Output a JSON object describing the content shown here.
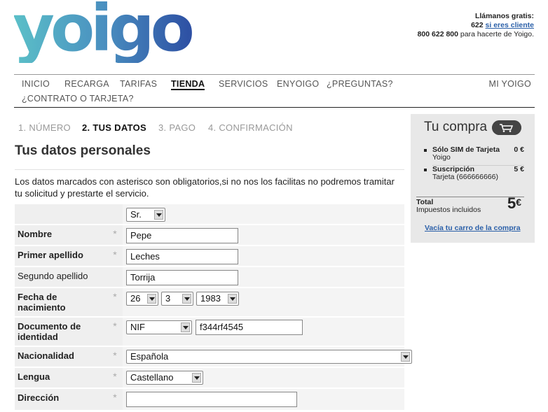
{
  "logo": {
    "text": "yoigo"
  },
  "contact": {
    "line1": "Llámanos gratis:",
    "line2_num": "622",
    "line2_link": "si eres cliente",
    "line3_num": "800 622 800",
    "line3_rest": " para hacerte de Yoigo."
  },
  "nav": {
    "items": [
      "INICIO",
      "RECARGA",
      "TARIFAS",
      "TIENDA",
      "SERVICIOS",
      "ENYOIGO",
      "¿PREGUNTAS?",
      "MI YOIGO",
      "¿CONTRATO O TARJETA?"
    ]
  },
  "steps": [
    "1. NÚMERO",
    "2. TUS DATOS",
    "3. PAGO",
    "4. CONFIRMACIÓN"
  ],
  "page": {
    "title": "Tus datos personales",
    "intro": "Los datos marcados con asterisco son obligatorios,si no nos los facilitas no podremos tramitar tu solicitud y prestarte el servicio."
  },
  "form": {
    "star": "*",
    "salutation": "Sr.",
    "nombre_label": "Nombre",
    "nombre_value": "Pepe",
    "apellido1_label": "Primer apellido",
    "apellido1_value": "Leches",
    "apellido2_label": "Segundo apellido",
    "apellido2_value": "Torrija",
    "fecha_label": "Fecha de nacimiento",
    "fecha_day": "26",
    "fecha_month": "3",
    "fecha_year": "1983",
    "doc_label": "Documento de identidad",
    "doc_type": "NIF",
    "doc_value": "f344rf4545",
    "nac_label": "Nacionalidad",
    "nac_value": "Española",
    "lengua_label": "Lengua",
    "lengua_value": "Castellano",
    "dir_label": "Dirección",
    "dir_value": ""
  },
  "cart": {
    "title": "Tu compra",
    "items": [
      {
        "name": "Sólo SIM de Tarjeta",
        "detail": "Yoigo",
        "price": "0 €"
      },
      {
        "name": "Suscripción",
        "detail": "Tarjeta (666666666)",
        "price": "5 €"
      }
    ],
    "total_label": "Total",
    "total_sub": "Impuestos incluidos",
    "total_value": "5",
    "total_currency": "€",
    "empty_link": "Vacía tu carro de la compra"
  },
  "colors": {
    "brand_gradient_start": "#5bc0c8",
    "brand_gradient_end": "#2d4fa3",
    "link": "#2a5fa8"
  }
}
